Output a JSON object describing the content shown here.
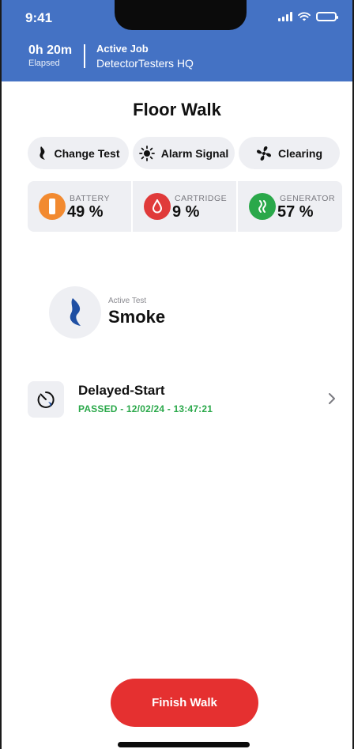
{
  "status_bar": {
    "time": "9:41"
  },
  "header": {
    "elapsed_value": "0h 20m",
    "elapsed_label": "Elapsed",
    "job_label": "Active Job",
    "job_name": "DetectorTesters HQ",
    "color": "#4472c4"
  },
  "page_title": "Floor Walk",
  "actions": [
    {
      "label": "Change Test",
      "icon": "flame-icon"
    },
    {
      "label": "Alarm Signal",
      "icon": "sun-icon"
    },
    {
      "label": "Clearing",
      "icon": "fan-icon"
    }
  ],
  "stats": [
    {
      "label": "BATTERY",
      "value": "49 %",
      "icon": "battery-icon",
      "color": "#f28a30"
    },
    {
      "label": "CARTRIDGE",
      "value": "9 %",
      "icon": "drop-icon",
      "color": "#e03a3a"
    },
    {
      "label": "GENERATOR",
      "value": "57 %",
      "icon": "flame-icon",
      "color": "#2aa84a"
    }
  ],
  "active_test": {
    "label": "Active Test",
    "value": "Smoke",
    "icon": "smoke-icon",
    "color": "#1f4fa3"
  },
  "result": {
    "title": "Delayed-Start",
    "status": "PASSED - 12/02/24 - 13:47:21",
    "status_color": "#2aa84a",
    "icon": "timer-icon"
  },
  "finish_button": {
    "label": "Finish Walk",
    "color": "#e53030"
  }
}
